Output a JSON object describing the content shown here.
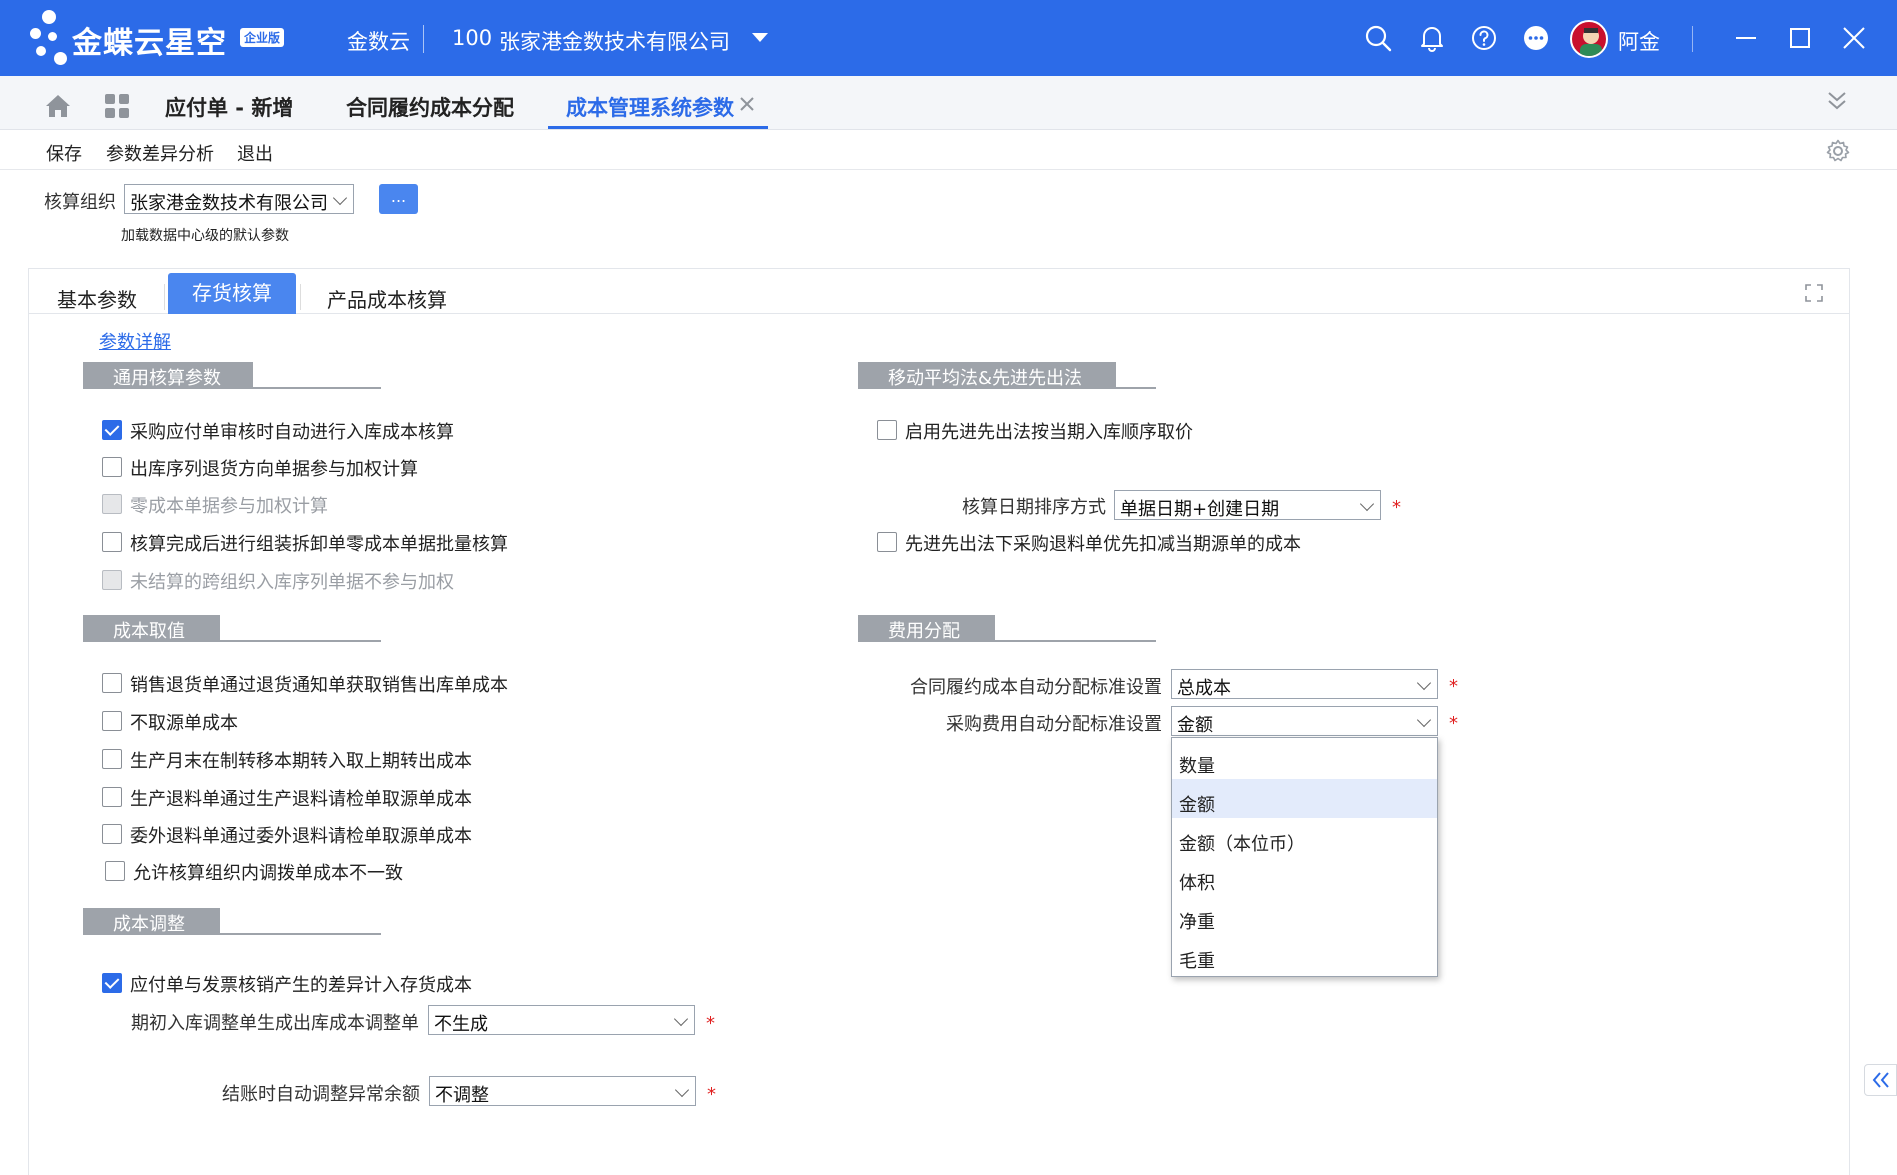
{
  "titlebar": {
    "brand": "金蝶云星空",
    "brand_badge": "企业版",
    "product": "金数云",
    "org_code": "100",
    "org_name": "张家港金数技术有限公司",
    "user_name": "阿金"
  },
  "tabs": [
    {
      "label": "应付单 - 新增"
    },
    {
      "label": "合同履约成本分配"
    },
    {
      "label": "成本管理系统参数"
    }
  ],
  "toolbar": {
    "save": "保存",
    "diff": "参数差异分析",
    "exit": "退出"
  },
  "org": {
    "label": "核算组织",
    "value": "张家港金数技术有限公司",
    "more": "...",
    "hint": "加载数据中心级的默认参数"
  },
  "panel_tabs": [
    {
      "label": "基本参数"
    },
    {
      "label": "存货核算"
    },
    {
      "label": "产品成本核算"
    }
  ],
  "param_link": "参数详解",
  "sections": {
    "general": {
      "title": "通用核算参数",
      "items": [
        {
          "label": "采购应付单审核时自动进行入库成本核算",
          "checked": true,
          "disabled": false
        },
        {
          "label": "出库序列退货方向单据参与加权计算",
          "checked": false,
          "disabled": false
        },
        {
          "label": "零成本单据参与加权计算",
          "checked": false,
          "disabled": true
        },
        {
          "label": "核算完成后进行组装拆卸单零成本单据批量核算",
          "checked": false,
          "disabled": false
        },
        {
          "label": "未结算的跨组织入库序列单据不参与加权",
          "checked": false,
          "disabled": true
        }
      ]
    },
    "cost_value": {
      "title": "成本取值",
      "items": [
        {
          "label": "销售退货单通过退货通知单获取销售出库单成本",
          "checked": false
        },
        {
          "label": "不取源单成本",
          "checked": false
        },
        {
          "label": "生产月末在制转移本期转入取上期转出成本",
          "checked": false
        },
        {
          "label": "生产退料单通过生产退料请检单取源单成本",
          "checked": false
        },
        {
          "label": "委外退料单通过委外退料请检单取源单成本",
          "checked": false
        },
        {
          "label": "允许核算组织内调拨单成本不一致",
          "checked": false
        }
      ]
    },
    "cost_adjust": {
      "title": "成本调整",
      "item": {
        "label": "应付单与发票核销产生的差异计入存货成本",
        "checked": true
      },
      "opening_label": "期初入库调整单生成出库成本调整单",
      "opening_value": "不生成",
      "closing_label": "结账时自动调整异常余额",
      "closing_value": "不调整"
    },
    "moving": {
      "title": "移动平均法&先进先出法",
      "fifo_order": {
        "label": "启用先进先出法按当期入库顺序取价",
        "checked": false
      },
      "date_sort_label": "核算日期排序方式",
      "date_sort_value": "单据日期+创建日期",
      "fifo_return": {
        "label": "先进先出法下采购退料单优先扣减当期源单的成本",
        "checked": false
      }
    },
    "expense": {
      "title": "费用分配",
      "contract_label": "合同履约成本自动分配标准设置",
      "contract_value": "总成本",
      "purchase_label": "采购费用自动分配标准设置",
      "purchase_value": "金额",
      "options": [
        "数量",
        "金额",
        "金额（本位币）",
        "体积",
        "净重",
        "毛重"
      ],
      "selected_index": 1
    }
  },
  "required_mark": "*"
}
